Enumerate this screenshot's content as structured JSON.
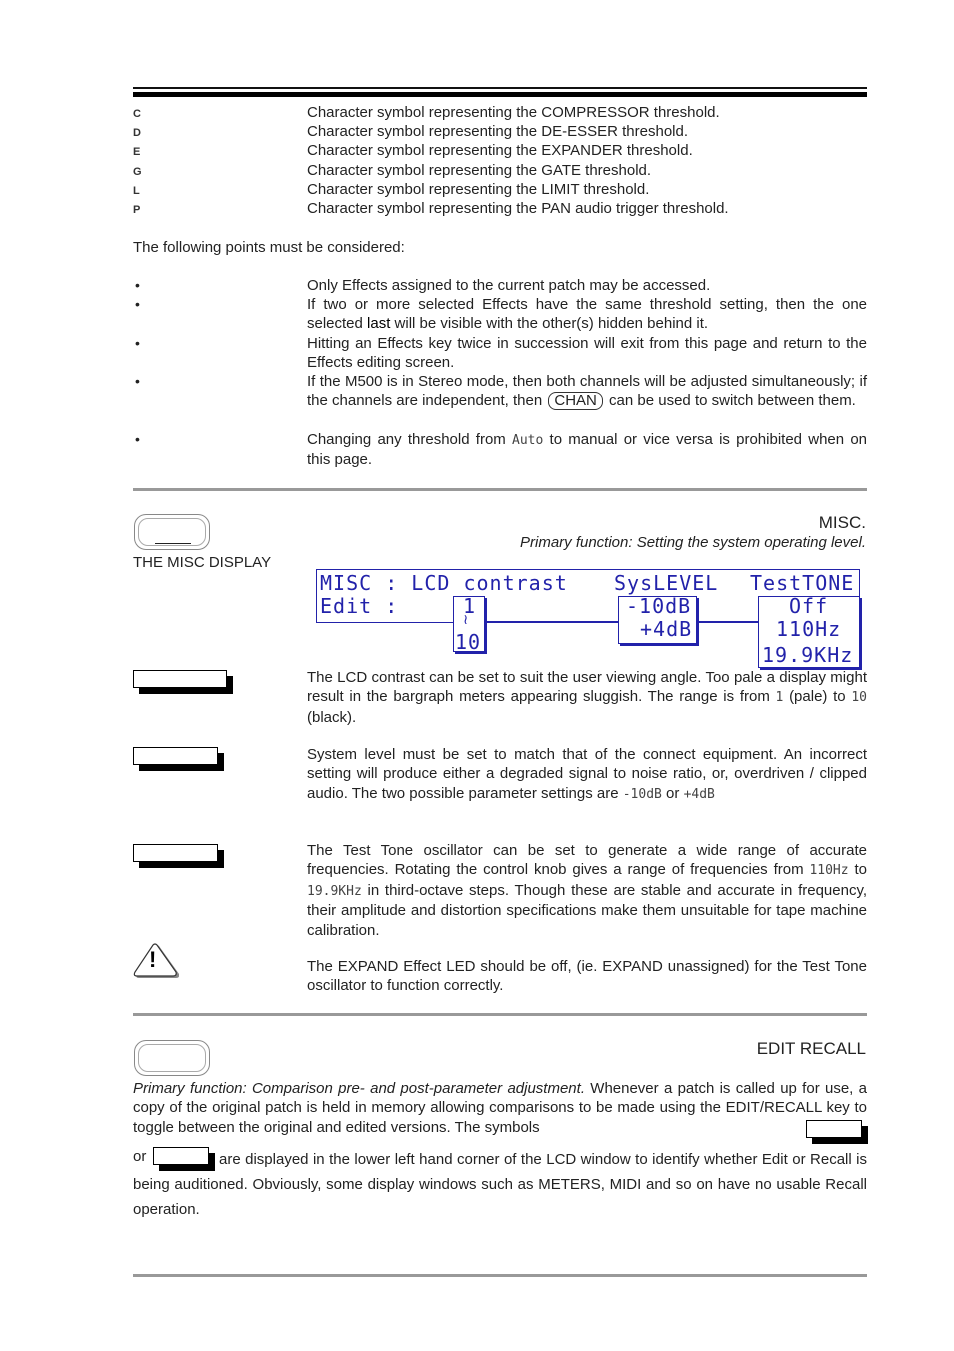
{
  "threshold_symbols": [
    {
      "symbol": "C",
      "description": "Character symbol representing the COMPRESSOR threshold."
    },
    {
      "symbol": "D",
      "description": "Character symbol representing the DE-ESSER threshold."
    },
    {
      "symbol": "E",
      "description": "Character symbol representing the EXPANDER threshold."
    },
    {
      "symbol": "G",
      "description": "Character symbol representing the GATE threshold."
    },
    {
      "symbol": "L",
      "description": "Character symbol representing the LIMIT threshold."
    },
    {
      "symbol": "P",
      "description": "Character symbol representing the PAN audio trigger threshold."
    }
  ],
  "points_intro": "The following points must be considered:",
  "bullet_glyph": "•",
  "points": {
    "p1": "Only Effects assigned to the current patch may be accessed.",
    "p2_a": "If two or more selected Effects have the same threshold setting, then the one selected ",
    "p2_b": "last",
    "p2_c": " will be visible with the other(s) hidden behind it.",
    "p3": "Hitting an Effects key twice in succession will exit from this page and return to the Effects editing screen.",
    "p4_a": "If the M500 is in Stereo mode, then both channels will be adjusted simultaneously; if the channels are independent, then ",
    "p4_key": "CHAN",
    "p4_c": " can be used to switch between them.",
    "p5_a": "Changing any threshold from ",
    "p5_b": "Auto",
    "p5_c": " to manual or vice versa is prohibited when on this page."
  },
  "misc": {
    "title": "MISC.",
    "subtitle": "Primary function: Setting the system operating level.",
    "display_label": "THE MISC DISPLAY",
    "lcd": {
      "row1_left": "MISC : LCD contrast",
      "row1_mid": "SysLEVEL",
      "row1_right": "TestTONE",
      "row2_left": "Edit :",
      "contrast_top": "1",
      "contrast_tilde": "≀",
      "contrast_bottom": "10",
      "syslevel_top": "-10dB",
      "syslevel_bottom": "+4dB",
      "tone_1": "Off",
      "tone_2": "110Hz",
      "tone_3": "19.9KHz"
    },
    "contrast_text_a": "The LCD contrast can be set to suit the user viewing angle. Too pale a display might result in the bargraph meters appearing sluggish. The range is from ",
    "contrast_min": "1",
    "contrast_text_b": " (pale) to ",
    "contrast_max": "10",
    "contrast_text_c": " (black).",
    "syslevel_text_a": "System level must be set to match that of the connect equipment. An incorrect setting will produce either a degraded signal to noise ratio, or, overdriven / clipped audio. The two possible parameter settings are ",
    "syslevel_opt1": "-10dB",
    "syslevel_text_b": " or ",
    "syslevel_opt2": "+4dB",
    "tone_text_a": "The Test Tone oscillator can be set to generate a wide range of accurate frequencies. Rotating the control knob gives a range of frequencies from ",
    "tone_min": "110Hz",
    "tone_text_b": " to ",
    "tone_max": "19.9KHz",
    "tone_text_c": " in third-octave steps. Though these are stable and accurate in frequency, their amplitude and distortion specifications make them unsuitable for tape machine calibration.",
    "warning_glyph": "!",
    "warning_text": "The EXPAND Effect LED should be off, (ie. EXPAND unassigned) for the Test Tone oscillator to function correctly."
  },
  "edit_recall": {
    "title": "EDIT RECALL",
    "text_italic": "Primary function: Comparison pre- and post-parameter adjustment.",
    "text_a": " Whenever a patch is called up for use, a copy of the original patch is held in memory allowing comparisons to be made using the EDIT/RECALL key to toggle between the original and edited versions. The symbols ",
    "text_or": "or",
    "text_b": " are displayed in the lower left hand corner of the LCD window to identify whether Edit or Recall is being auditioned. Obviously, some display windows such as METERS, MIDI and so on have no usable Recall operation."
  }
}
